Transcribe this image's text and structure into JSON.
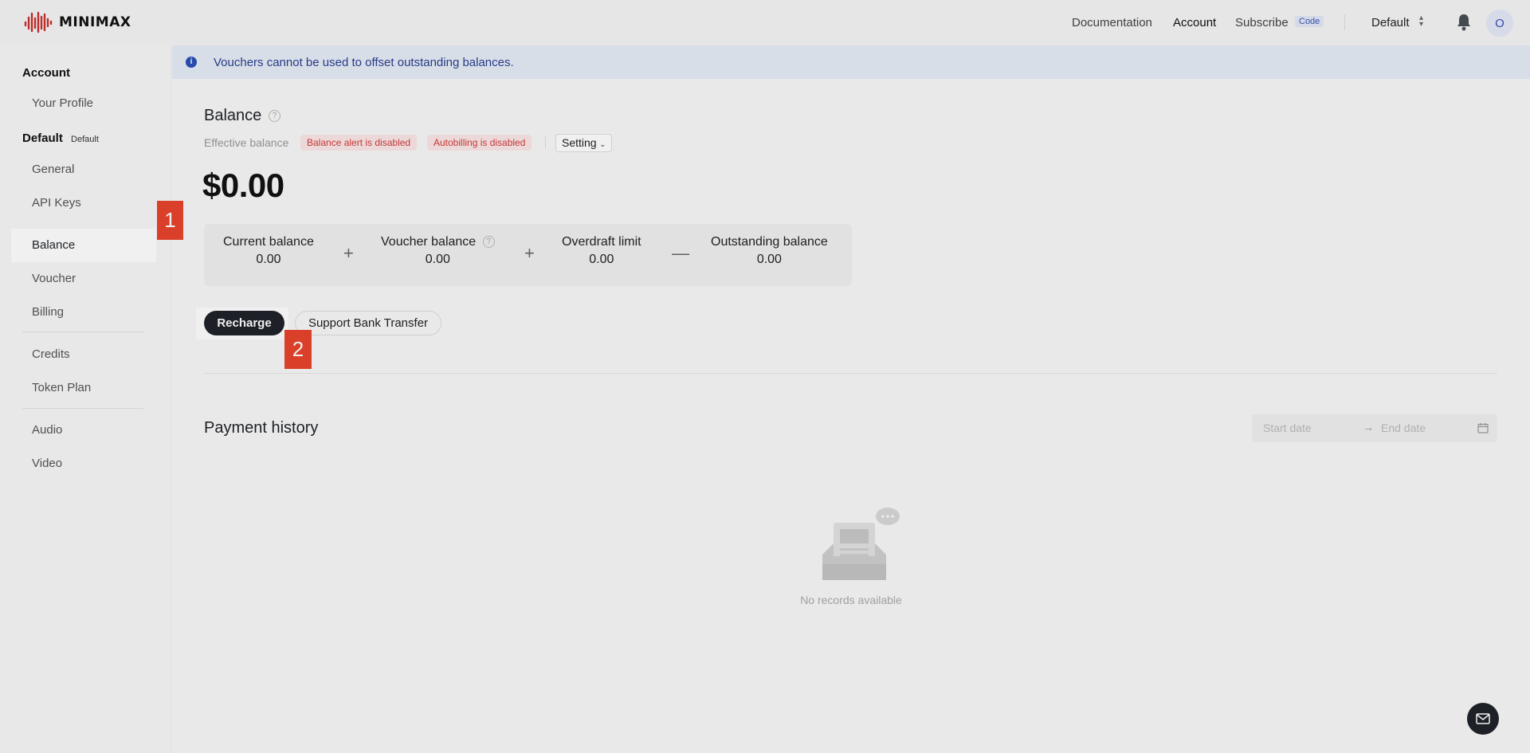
{
  "header": {
    "logo_text": "MINIMAX",
    "nav": {
      "documentation": "Documentation",
      "account": "Account",
      "subscribe": "Subscribe",
      "subscribe_badge": "Code"
    },
    "workspace": "Default",
    "avatar_initial": "O"
  },
  "sidebar": {
    "account_group": "Account",
    "your_profile": "Your Profile",
    "default_group": "Default",
    "default_tag": "Default",
    "items": {
      "general": "General",
      "api_keys": "API Keys",
      "balance": "Balance",
      "voucher": "Voucher",
      "billing": "Billing",
      "credits": "Credits",
      "token_plan": "Token Plan",
      "audio": "Audio",
      "video": "Video"
    }
  },
  "alert": {
    "text": "Vouchers cannot be used to offset outstanding balances."
  },
  "balance": {
    "title": "Balance",
    "effective_label": "Effective balance",
    "alert_status": "Balance alert is disabled",
    "autobilling_status": "Autobilling is disabled",
    "setting_label": "Setting",
    "amount": "$0.00",
    "breakdown": {
      "current_label": "Current balance",
      "current_value": "0.00",
      "voucher_label": "Voucher balance",
      "voucher_value": "0.00",
      "overdraft_label": "Overdraft limit",
      "overdraft_value": "0.00",
      "outstanding_label": "Outstanding balance",
      "outstanding_value": "0.00",
      "op_plus": "+",
      "op_minus": "—"
    },
    "recharge_label": "Recharge",
    "bank_transfer_label": "Support Bank Transfer"
  },
  "annotations": {
    "badge1": "1",
    "badge2": "2"
  },
  "payment_history": {
    "title": "Payment history",
    "start_placeholder": "Start date",
    "arrow": "→",
    "end_placeholder": "End date",
    "empty_text": "No records available"
  },
  "colors": {
    "accent_dark": "#1f2329",
    "annotation_red": "#e8452c",
    "alert_bg": "#e6ecf7",
    "status_red": "#d23b3b"
  }
}
